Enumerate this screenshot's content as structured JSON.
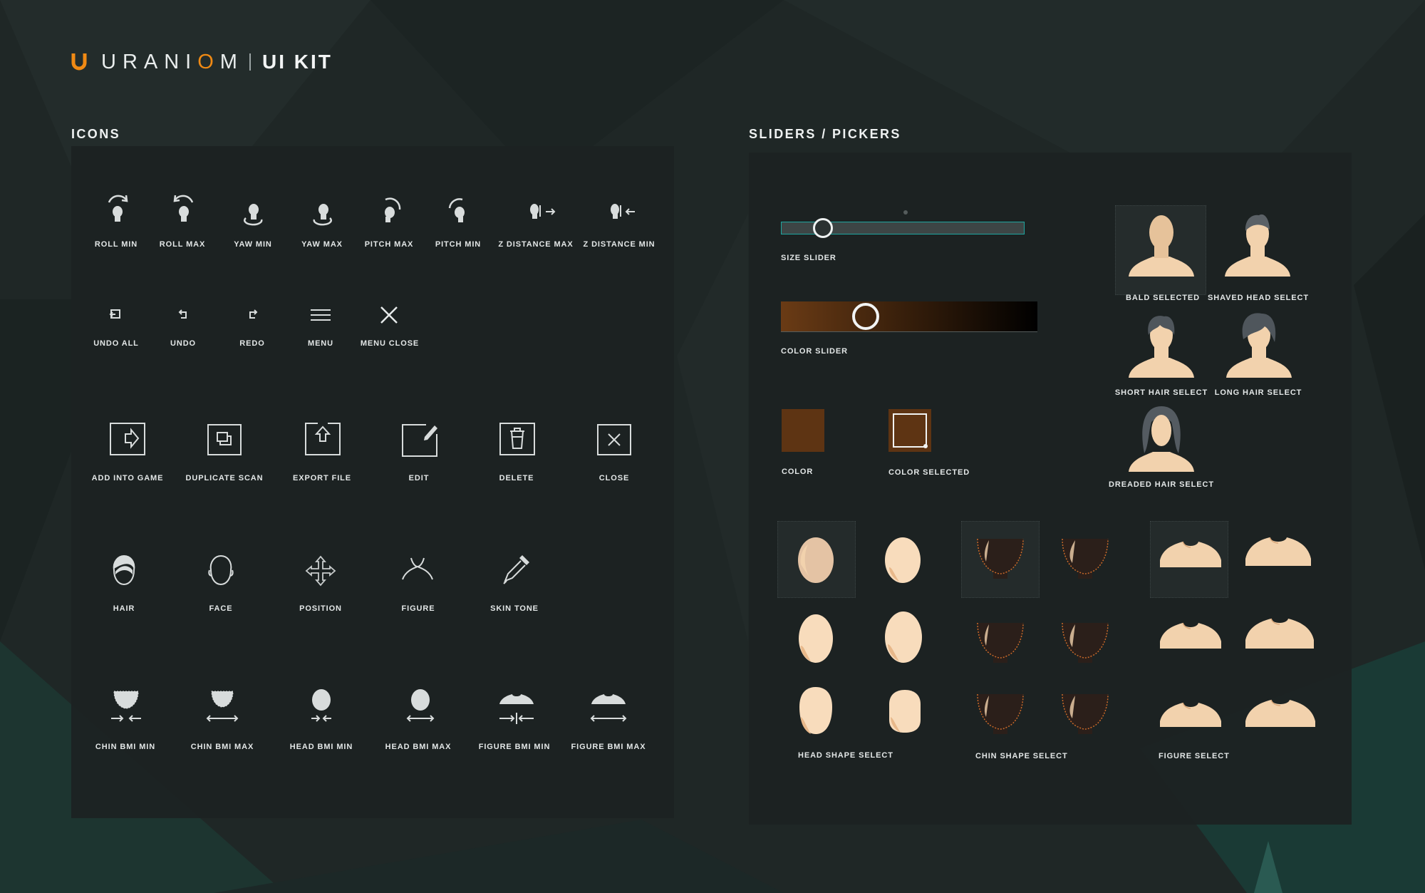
{
  "brand": {
    "name_pre": "URANI",
    "name_o": "O",
    "name_post": "M",
    "kit": "UI KIT",
    "accent_color": "#f08a14"
  },
  "sections": {
    "icons": "ICONS",
    "sliders": "SLIDERS / PICKERS"
  },
  "icons": {
    "row1": [
      "ROLL MIN",
      "ROLL MAX",
      "YAW MIN",
      "YAW MAX",
      "PITCH MAX",
      "PITCH MIN",
      "Z DISTANCE MAX",
      "Z DISTANCE MIN"
    ],
    "row2": [
      "UNDO ALL",
      "UNDO",
      "REDO",
      "MENU",
      "MENU CLOSE"
    ],
    "row3": [
      "ADD INTO GAME",
      "DUPLICATE SCAN",
      "EXPORT FILE",
      "EDIT",
      "DELETE",
      "CLOSE"
    ],
    "row4": [
      "HAIR",
      "FACE",
      "POSITION",
      "FIGURE",
      "SKIN TONE"
    ],
    "row5": [
      "CHIN BMI MIN",
      "CHIN BMI MAX",
      "HEAD BMI MIN",
      "HEAD BMI MAX",
      "FIGURE BMI MIN",
      "FIGURE BMI MAX"
    ]
  },
  "sliders": {
    "size_label": "SIZE SLIDER",
    "size_value": 0.17,
    "size_accent": "#1fa6a0",
    "color_label": "COLOR SLIDER",
    "color_value": 0.33,
    "color_start": "#6a3b15",
    "color_end": "#000000"
  },
  "swatches": {
    "color_label": "COLOR",
    "color_selected_label": "COLOR SELECTED",
    "color": "#5e3413"
  },
  "hair": {
    "bald": "BALD SELECTED",
    "shaved": "SHAVED HEAD SELECT",
    "short": "SHORT HAIR SELECT",
    "long": "LONG HAIR SELECT",
    "dreaded": "DREADED HAIR SELECT"
  },
  "shapes": {
    "head": "HEAD SHAPE SELECT",
    "chin": "CHIN SHAPE SELECT",
    "figure": "FIGURE SELECT"
  },
  "skin_color": "#f2d2ad"
}
